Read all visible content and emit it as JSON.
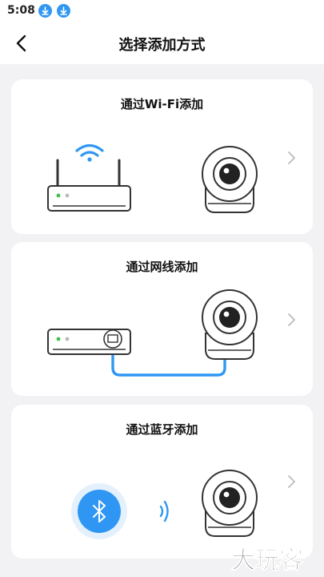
{
  "status_bar": {
    "time": "5:08",
    "icons": [
      "download-icon",
      "download-icon"
    ]
  },
  "header": {
    "title": "选择添加方式",
    "back_icon": "back-arrow-icon"
  },
  "options": [
    {
      "title": "通过Wi-Fi添加",
      "illustration": "wifi-router-camera"
    },
    {
      "title": "通过网线添加",
      "illustration": "ethernet-router-camera"
    },
    {
      "title": "通过蓝牙添加",
      "illustration": "bluetooth-camera"
    }
  ],
  "watermark": {
    "text": "大玩客"
  },
  "colors": {
    "accent": "#2f97f3",
    "background": "#f2f2f4",
    "card": "#ffffff",
    "led_green": "#3fbf4f"
  }
}
